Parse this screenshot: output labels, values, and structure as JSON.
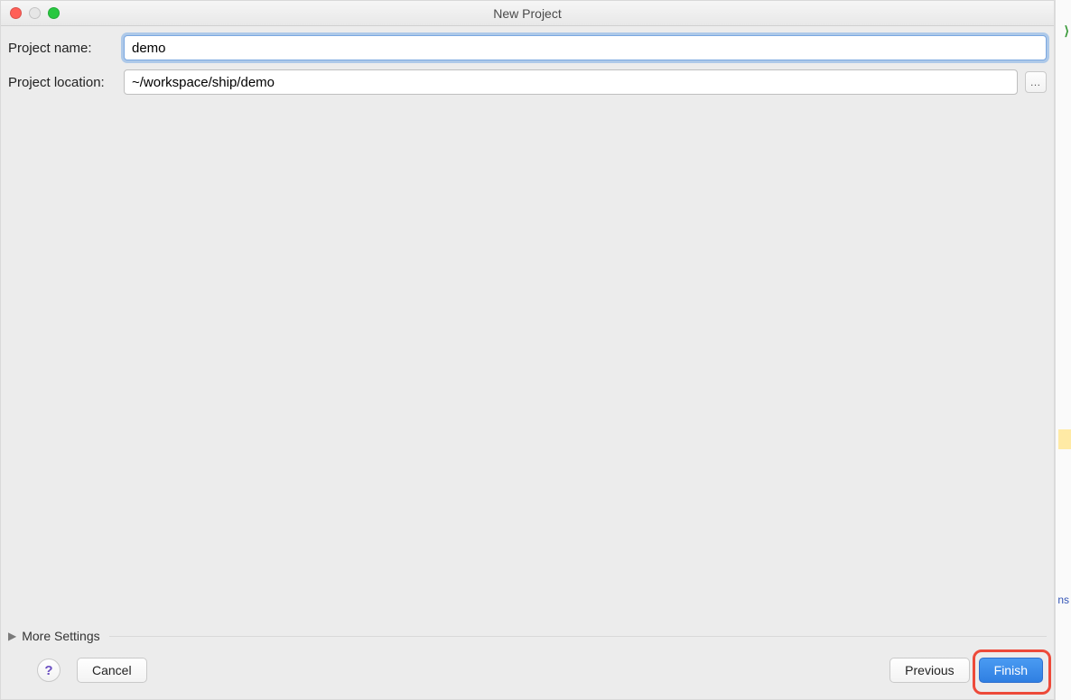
{
  "window": {
    "title": "New Project"
  },
  "form": {
    "project_name_label": "Project name:",
    "project_name_value": "demo",
    "project_location_label": "Project location:",
    "project_location_value": "~/workspace/ship/demo",
    "browse_label": "…"
  },
  "more_settings": {
    "label": "More Settings"
  },
  "footer": {
    "help_label": "?",
    "cancel_label": "Cancel",
    "previous_label": "Previous",
    "finish_label": "Finish"
  },
  "highlight": {
    "target": "finish-button"
  }
}
